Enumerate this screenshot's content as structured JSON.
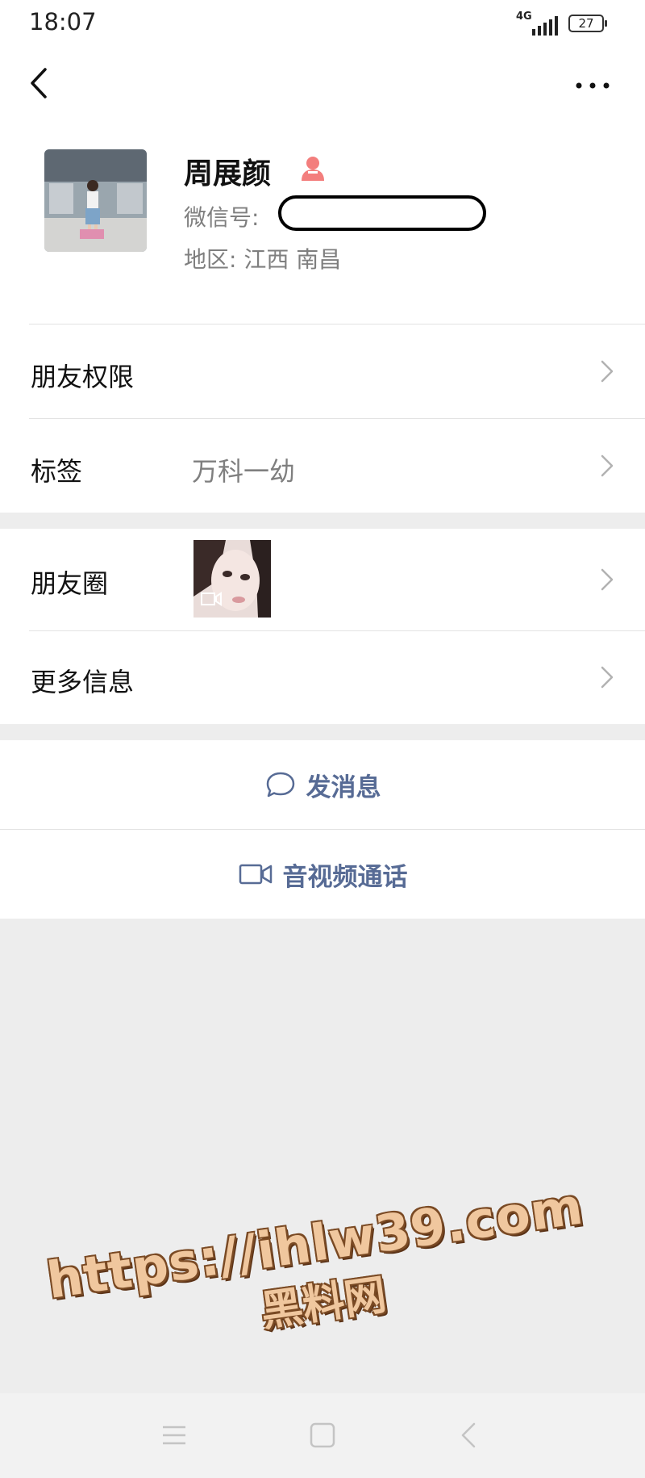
{
  "status_bar": {
    "time": "18:07",
    "network": "4G",
    "battery": "27"
  },
  "nav": {
    "back_icon": "chevron-left-icon",
    "more_icon": "ellipsis-icon"
  },
  "profile": {
    "name": "周展颜",
    "gender_icon": "female-user-icon",
    "gender_color": "#f37e7d",
    "wechat_id_label": "微信号:",
    "region_label": "地区:  江西 南昌"
  },
  "rows": {
    "permissions": {
      "label": "朋友权限"
    },
    "tags": {
      "label": "标签",
      "value": "万科一幼"
    },
    "moments": {
      "label": "朋友圈"
    },
    "more_info": {
      "label": "更多信息"
    }
  },
  "actions": {
    "message": {
      "label": "发消息",
      "icon": "chat-bubble-icon"
    },
    "call": {
      "label": "音视频通话",
      "icon": "video-camera-icon"
    }
  },
  "watermark": {
    "url": "https://ihlw39.com",
    "site": "黑料网"
  },
  "colors": {
    "link_blue": "#576b95",
    "page_bg": "#ededed"
  }
}
